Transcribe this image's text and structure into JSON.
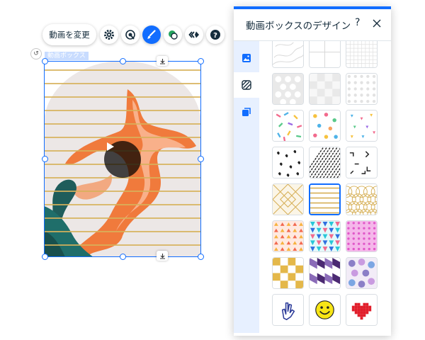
{
  "toolbar": {
    "change_video_label": "動画を変更",
    "buttons": [
      "settings-icon",
      "animation-icon",
      "design-brush-icon",
      "mask-icon",
      "navigate-icon",
      "help-icon"
    ]
  },
  "component": {
    "label": "動画ボックス"
  },
  "panel": {
    "title": "動画ボックスのデザイン",
    "help": "?",
    "tabs": [
      "image-icon",
      "pattern-icon",
      "layers-icon"
    ],
    "selected_tab": "pattern-icon",
    "patterns": [
      [
        "topo-lines",
        "big-grid",
        "fine-grid"
      ],
      [
        "white-dots",
        "white-checks",
        "grey-dots"
      ],
      [
        "confetti-sticks",
        "confetti-dots",
        "confetti-triangles"
      ],
      [
        "ink-brush",
        "diagonal-hatch",
        "squiggles"
      ],
      [
        "gold-deco",
        "gold-stripes",
        "gold-scales"
      ],
      [
        "coral-triangles",
        "cyan-triangles",
        "pink-dots"
      ],
      [
        "gold-checker",
        "purple-chevron",
        "purple-bubbles"
      ],
      [
        "hand-sign-sticker",
        "smiley-sticker",
        "pixel-heart-sticker"
      ]
    ],
    "selected_pattern": "gold-stripes"
  },
  "colors": {
    "accent": "#116dff",
    "panel_side": "#e7f0ff",
    "gold": "#d7b15a"
  }
}
